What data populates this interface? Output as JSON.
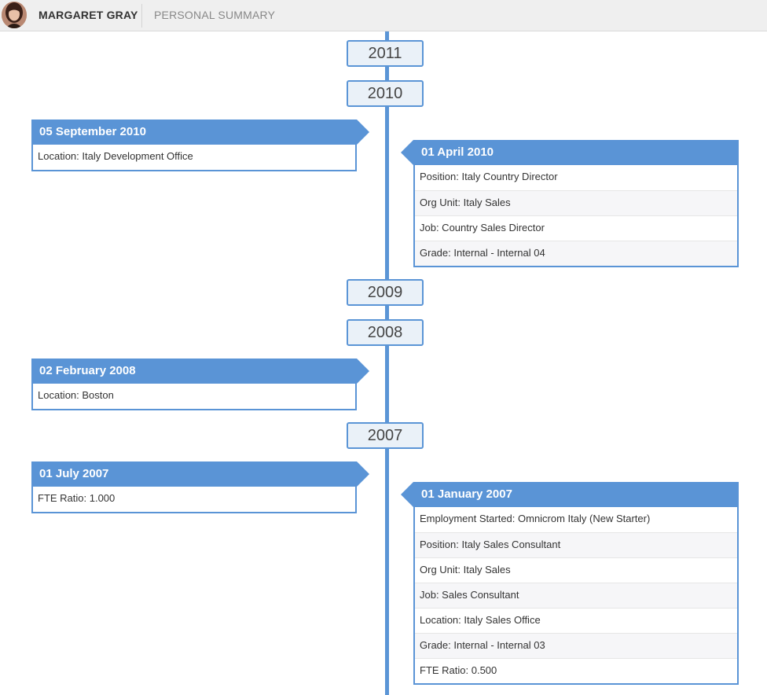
{
  "header": {
    "user_name": "MARGARET GRAY",
    "tab_label": "PERSONAL SUMMARY"
  },
  "colors": {
    "accent": "#5a94d6",
    "year_fill": "#eaf1f8"
  },
  "timeline": {
    "years": [
      "2011",
      "2010",
      "2009",
      "2008",
      "2007"
    ],
    "events": [
      {
        "date": "05 September 2010",
        "side": "left",
        "rows": [
          "Location: Italy Development Office"
        ]
      },
      {
        "date": "01 April 2010",
        "side": "right",
        "rows": [
          "Position: Italy Country Director",
          "Org Unit: Italy Sales",
          "Job: Country Sales Director",
          "Grade: Internal - Internal 04"
        ]
      },
      {
        "date": "02 February 2008",
        "side": "left",
        "rows": [
          "Location: Boston"
        ]
      },
      {
        "date": "01 July 2007",
        "side": "left",
        "rows": [
          "FTE Ratio: 1.000"
        ]
      },
      {
        "date": "01 January 2007",
        "side": "right",
        "rows": [
          "Employment Started: Omnicrom Italy (New Starter)",
          "Position: Italy Sales Consultant",
          "Org Unit: Italy Sales",
          "Job: Sales Consultant",
          "Location: Italy Sales Office",
          "Grade: Internal - Internal 03",
          "FTE Ratio: 0.500"
        ]
      }
    ]
  }
}
